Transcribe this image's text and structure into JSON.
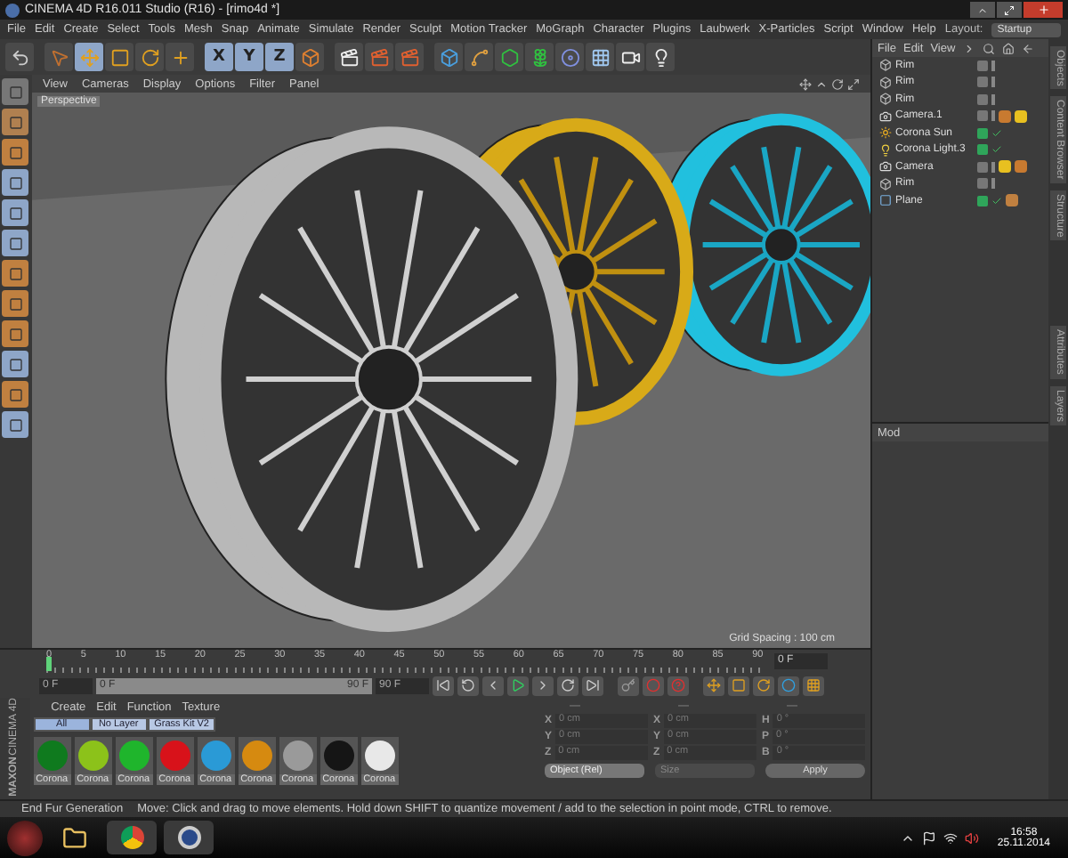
{
  "window": {
    "title": "CINEMA 4D R16.011 Studio (R16) - [rimo4d *]"
  },
  "menu": [
    "File",
    "Edit",
    "Create",
    "Select",
    "Tools",
    "Mesh",
    "Snap",
    "Animate",
    "Simulate",
    "Render",
    "Sculpt",
    "Motion Tracker",
    "MoGraph",
    "Character",
    "Plugins",
    "Laubwerk",
    "X-Particles",
    "Script",
    "Window",
    "Help"
  ],
  "layout": {
    "label": "Layout:",
    "value": "Startup"
  },
  "axis_buttons": [
    {
      "label": "X",
      "selected": true
    },
    {
      "label": "Y",
      "selected": true
    },
    {
      "label": "Z",
      "selected": true
    }
  ],
  "viewport": {
    "menu": [
      "View",
      "Cameras",
      "Display",
      "Options",
      "Filter",
      "Panel"
    ],
    "camera": "Perspective",
    "grid_spacing": "Grid Spacing : 100 cm"
  },
  "object_manager": {
    "menu": [
      "File",
      "Edit",
      "View"
    ],
    "objects": [
      {
        "name": "Rim",
        "kind": "null",
        "enabled": false
      },
      {
        "name": "Rim",
        "kind": "null",
        "enabled": false
      },
      {
        "name": "Rim",
        "kind": "null",
        "enabled": false
      },
      {
        "name": "Camera.1",
        "kind": "camera",
        "enabled": false,
        "tags": [
          {
            "kind": "protection"
          },
          {
            "kind": "compositing"
          }
        ]
      },
      {
        "name": "Corona Sun",
        "kind": "sun",
        "enabled": true
      },
      {
        "name": "Corona Light.3",
        "kind": "light",
        "enabled": true
      },
      {
        "name": "Camera",
        "kind": "camera",
        "enabled": false,
        "tags": [
          {
            "kind": "compositing"
          },
          {
            "kind": "protection"
          }
        ]
      },
      {
        "name": "Rim",
        "kind": "null",
        "enabled": false
      },
      {
        "name": "Plane",
        "kind": "plane",
        "enabled": true,
        "tags": [
          {
            "kind": "phong"
          }
        ]
      }
    ]
  },
  "side_tabs": [
    "Objects",
    "Content Browser",
    "Structure"
  ],
  "attribute_manager": {
    "mode": "Mod",
    "side_tabs": [
      "Attributes",
      "Layers"
    ]
  },
  "timeline": {
    "ticks": [
      "0",
      "5",
      "10",
      "15",
      "20",
      "25",
      "30",
      "35",
      "40",
      "45",
      "50",
      "55",
      "60",
      "65",
      "70",
      "75",
      "80",
      "85",
      "90"
    ],
    "current_frame": "0 F",
    "start": "0 F",
    "range_start": "0 F",
    "range_end": "90 F",
    "end": "90 F",
    "level": 0
  },
  "material_manager": {
    "menu": [
      "Create",
      "Edit",
      "Function",
      "Texture"
    ],
    "layers": [
      {
        "label": "All",
        "selected": true
      },
      {
        "label": "No Layer",
        "selected": false
      },
      {
        "label": "Grass Kit V2",
        "selected": false
      }
    ],
    "logo": {
      "brand": "MAXON",
      "product": "CINEMA 4D"
    },
    "materials": [
      {
        "name": "Corona",
        "color": "#0f7a1e"
      },
      {
        "name": "Corona",
        "color": "#8cc21a"
      },
      {
        "name": "Corona",
        "color": "#1fb52c"
      },
      {
        "name": "Corona",
        "color": "#d8121a"
      },
      {
        "name": "Corona",
        "color": "#2a9ad6"
      },
      {
        "name": "Corona",
        "color": "#d68a10"
      },
      {
        "name": "Corona",
        "color": "#9a9a9a"
      },
      {
        "name": "Corona",
        "color": "#151515"
      },
      {
        "name": "Corona",
        "color": "#e8e8e8"
      }
    ]
  },
  "coordinates": {
    "headers": [
      "—",
      "—",
      "—"
    ],
    "rows": [
      [
        {
          "axis": "X",
          "value": "0 cm"
        },
        {
          "axis": "X",
          "value": "0 cm"
        },
        {
          "axis": "H",
          "value": "0 °"
        }
      ],
      [
        {
          "axis": "Y",
          "value": "0 cm"
        },
        {
          "axis": "Y",
          "value": "0 cm"
        },
        {
          "axis": "P",
          "value": "0 °"
        }
      ],
      [
        {
          "axis": "Z",
          "value": "0 cm"
        },
        {
          "axis": "Z",
          "value": "0 cm"
        },
        {
          "axis": "B",
          "value": "0 °"
        }
      ]
    ],
    "mode": "Object (Rel)",
    "size": "Size",
    "apply": "Apply"
  },
  "status_bar": {
    "task": "End Fur Generation",
    "hint": "Move: Click and drag to move elements. Hold down SHIFT to quantize movement / add to the selection in point mode, CTRL to remove."
  },
  "taskbar": {
    "time": "16:58",
    "date": "25.11.2014"
  }
}
